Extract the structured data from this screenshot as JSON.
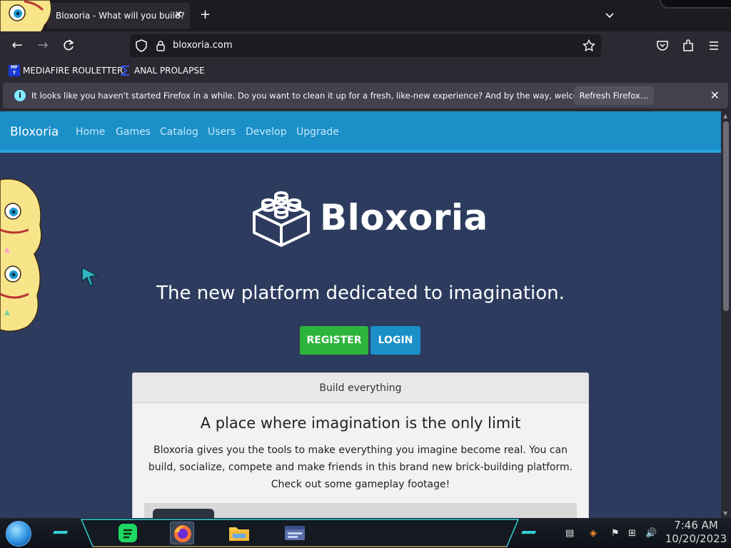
{
  "browser": {
    "tab_title": "Bloxoria - What will you build?",
    "url": "bloxoria.com"
  },
  "bookmarks": [
    {
      "label": "MEDIAFIRE ROULETTER",
      "icon": "mediafire-icon"
    },
    {
      "label": "ANAL PROLAPSE",
      "icon": "sigma-icon"
    }
  ],
  "notification": {
    "message": "It looks like you haven't started Firefox in a while. Do you want to clean it up for a fresh, like-new experience? And by the way, welcome back!",
    "button_label": "Refresh Firefox…"
  },
  "site": {
    "brand": "Bloxoria",
    "nav": [
      "Home",
      "Games",
      "Catalog",
      "Users",
      "Develop",
      "Upgrade"
    ],
    "logo_text": "Bloxoria",
    "tagline": "The new platform dedicated to imagination.",
    "register_label": "REGISTER",
    "login_label": "LOGIN",
    "card": {
      "header": "Build everything",
      "title": "A place where imagination is the only limit",
      "body": "Bloxoria gives you the tools to make everything you imagine become real. You can build, socialize, compete and make friends in this brand new brick-building platform. Check out some gameplay footage!"
    }
  },
  "colors": {
    "site_nav": "#1a8fc8",
    "page_bg": "#2d3c5e",
    "register": "#2db43c",
    "login": "#1a8fc8"
  },
  "taskbar": {
    "time": "7:46 AM",
    "date": "10/20/2023",
    "apps": [
      "spotify-icon",
      "firefox-icon",
      "file-explorer-icon",
      "window-app-icon"
    ]
  }
}
